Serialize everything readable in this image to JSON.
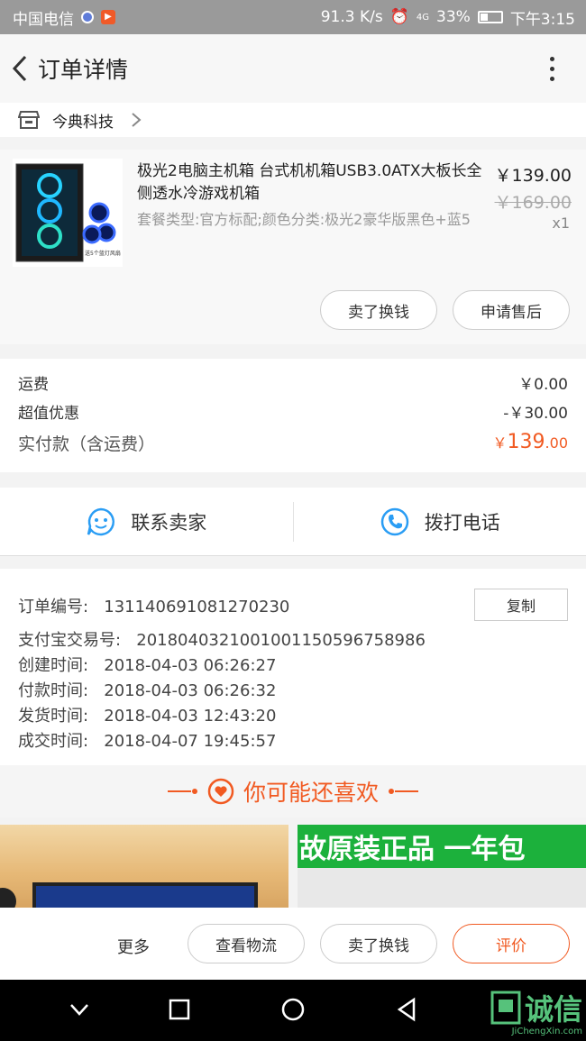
{
  "status_bar": {
    "carrier": "中国电信",
    "speed": "91.3 K/s",
    "net": "4G",
    "battery": "33%",
    "time": "下午3:15"
  },
  "header": {
    "title": "订单详情"
  },
  "shop": {
    "name": "今典科技"
  },
  "product": {
    "title": "极光2电脑主机箱 台式机机箱USB3.0ATX大板长全侧透水冷游戏机箱",
    "spec": "套餐类型:官方标配;颜色分类:极光2豪华版黑色+蓝5",
    "price": "￥139.00",
    "original_price": "￥169.00",
    "quantity": "x1",
    "thumb_caption": "送5个蓝灯风扇",
    "btn_sell": "卖了换钱",
    "btn_aftersale": "申请售后"
  },
  "fees": {
    "shipping_label": "运费",
    "shipping_value": "￥0.00",
    "discount_label": "超值优惠",
    "discount_value": "-￥30.00",
    "paid_label": "实付款（含运费）",
    "paid_currency": "￥",
    "paid_int": "139",
    "paid_dec": ".00"
  },
  "contact": {
    "seller": "联系卖家",
    "call": "拨打电话"
  },
  "info": {
    "order_no_label": "订单编号:",
    "order_no": "131140691081270230",
    "copy": "复制",
    "alipay_label": "支付宝交易号:",
    "alipay": "2018040321001001150596758986",
    "created_label": "创建时间:",
    "created": "2018-04-03 06:26:27",
    "paid_label": "付款时间:",
    "paid": "2018-04-03 06:26:32",
    "shipped_label": "发货时间:",
    "shipped": "2018-04-03 12:43:20",
    "done_label": "成交时间:",
    "done": "2018-04-07 19:45:57"
  },
  "recommend": {
    "title": "你可能还喜欢",
    "banner_text": "故原装正品 一年包"
  },
  "actions": {
    "more": "更多",
    "logistics": "查看物流",
    "sell": "卖了换钱",
    "review": "评价"
  },
  "watermark": {
    "text": "诚信",
    "url": "JiChengXin.com"
  },
  "colors": {
    "accent": "#f15a22",
    "contact_blue": "#2a9df4"
  }
}
